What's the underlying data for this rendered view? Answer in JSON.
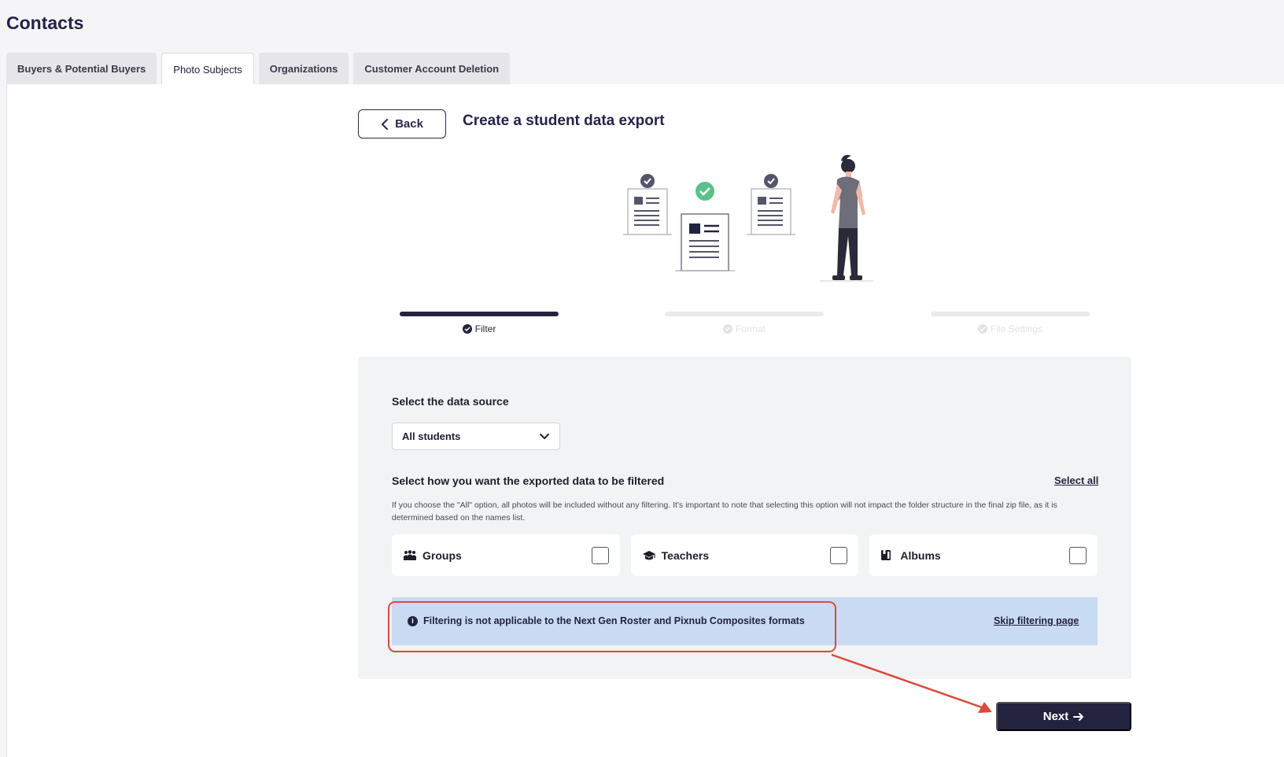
{
  "header": {
    "title": "Contacts"
  },
  "tabs": [
    {
      "label": "Buyers & Potential Buyers",
      "active": false
    },
    {
      "label": "Photo Subjects",
      "active": true
    },
    {
      "label": "Organizations",
      "active": false
    },
    {
      "label": "Customer Account Deletion",
      "active": false
    }
  ],
  "export": {
    "back_label": "Back",
    "title": "Create a student data export"
  },
  "steps": [
    {
      "label": "Filter",
      "state": "active"
    },
    {
      "label": "Format",
      "state": "inactive"
    },
    {
      "label": "File Settings",
      "state": "inactive"
    }
  ],
  "source": {
    "label": "Select the data source",
    "selected": "All students"
  },
  "filter": {
    "label": "Select how you want the exported data to be filtered",
    "select_all": "Select all",
    "description": "If you choose the \"All\" option, all photos will be included without any filtering. It's important to note that selecting this option will not impact the folder structure in the final zip file, as it is determined based on the names list.",
    "options": [
      {
        "label": "Groups",
        "icon": "groups-icon",
        "checked": false
      },
      {
        "label": "Teachers",
        "icon": "graduation-cap-icon",
        "checked": false
      },
      {
        "label": "Albums",
        "icon": "album-icon",
        "checked": false
      }
    ]
  },
  "info": {
    "text": "Filtering is not applicable to the Next Gen Roster and Pixnub Composites formats",
    "skip_label": "Skip filtering page"
  },
  "actions": {
    "next_label": "Next"
  },
  "colors": {
    "primary": "#23233f",
    "info_bg": "#c9daf3",
    "annotation": "#d94a3a",
    "success": "#5cc08a"
  }
}
